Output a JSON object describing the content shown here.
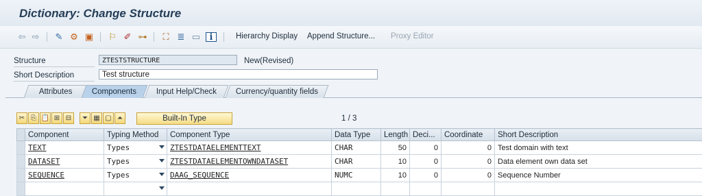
{
  "window": {
    "title": "Dictionary: Change Structure"
  },
  "toolbar": {
    "buttons": [
      {
        "name": "back-arrow-icon",
        "glyph": "⇦",
        "color": "#7d95ad"
      },
      {
        "name": "forward-arrow-icon",
        "glyph": "⇨",
        "color": "#7d95ad"
      },
      {
        "name": "edit-display-toggle-icon",
        "glyph": "✎",
        "color": "#3a6ea5"
      },
      {
        "name": "activate-icon",
        "glyph": "⚙",
        "color": "#c4621d"
      },
      {
        "name": "check-object-icon",
        "glyph": "▣",
        "color": "#c4621d"
      },
      {
        "name": "where-used-icon",
        "glyph": "⚐",
        "color": "#b88a14"
      },
      {
        "name": "pencil-icon",
        "glyph": "✐",
        "color": "#b03030"
      },
      {
        "name": "tree-icon",
        "glyph": "⊶",
        "color": "#b07020"
      },
      {
        "name": "hierarchy-icon",
        "glyph": "⛶",
        "color": "#b06020"
      },
      {
        "name": "align-icon",
        "glyph": "≣",
        "color": "#2c5f99"
      },
      {
        "name": "window-icon",
        "glyph": "▭",
        "color": "#6e8aa6"
      },
      {
        "name": "info-icon",
        "glyph": "ℹ",
        "color": "#1d4f8a"
      }
    ],
    "links": {
      "hierarchy_display": "Hierarchy Display",
      "append_structure": "Append Structure...",
      "proxy_editor": "Proxy Editor"
    }
  },
  "header": {
    "structure_label": "Structure",
    "structure_value": "ZTESTSTRUCTURE",
    "status": "New(Revised)",
    "short_desc_label": "Short Description",
    "short_desc_value": "Test structure"
  },
  "tabs": [
    "Attributes",
    "Components",
    "Input Help/Check",
    "Currency/quantity fields"
  ],
  "active_tab": "Components",
  "grid_toolbar": {
    "builtin_type_label": "Built-In Type",
    "pager": "1 / 3"
  },
  "table": {
    "columns": [
      "Component",
      "Typing Method",
      "Component Type",
      "Data Type",
      "Length",
      "Deci...",
      "Coordinate",
      "Short Description"
    ],
    "rows": [
      {
        "component": "TEXT",
        "typing": "Types",
        "comp_type": "ZTESTDATAELEMENTTEXT",
        "data_type": "CHAR",
        "length": "50",
        "dec": "0",
        "coord": "0",
        "desc": "Test domain with text"
      },
      {
        "component": "DATASET",
        "typing": "Types",
        "comp_type": "ZTESTDATAELEMENTOWNDATASET",
        "data_type": "CHAR",
        "length": "10",
        "dec": "0",
        "coord": "0",
        "desc": "Data element own data set"
      },
      {
        "component": "SEQUENCE",
        "typing": "Types",
        "comp_type": "DAAG_SEQUENCE",
        "data_type": "NUMC",
        "length": "10",
        "dec": "0",
        "coord": "0",
        "desc": "Sequence Number"
      },
      {
        "component": "",
        "typing": "",
        "comp_type": "",
        "data_type": "",
        "length": "",
        "dec": "",
        "coord": "",
        "desc": ""
      }
    ]
  }
}
